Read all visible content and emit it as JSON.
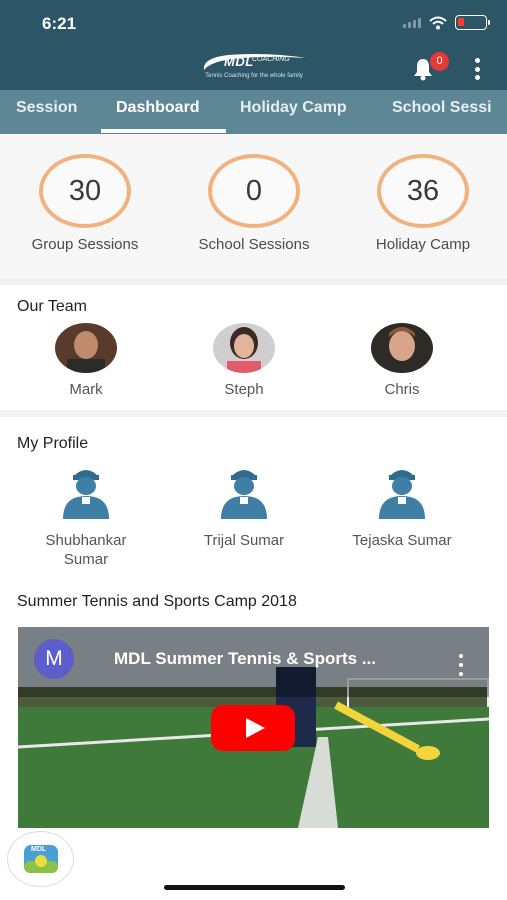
{
  "status_bar": {
    "time": "6:21"
  },
  "header": {
    "logo_main": "MDL",
    "logo_sub": "COACHING",
    "logo_tagline": "Tennis Coaching for the whole family",
    "notification_count": "0"
  },
  "tabs": [
    {
      "label": "Session"
    },
    {
      "label": "Dashboard",
      "active": true
    },
    {
      "label": "Holiday Camp"
    },
    {
      "label": "School Sessi"
    }
  ],
  "stats": [
    {
      "value": "30",
      "label": "Group Sessions"
    },
    {
      "value": "0",
      "label": "School Sessions"
    },
    {
      "value": "36",
      "label": "Holiday Camp"
    }
  ],
  "team": {
    "title": "Our Team",
    "members": [
      {
        "name": "Mark"
      },
      {
        "name": "Steph"
      },
      {
        "name": "Chris"
      }
    ]
  },
  "profile": {
    "title": "My Profile",
    "people": [
      {
        "name_line1": "Shubhankar",
        "name_line2": "Sumar"
      },
      {
        "name_line1": "Trijal Sumar",
        "name_line2": ""
      },
      {
        "name_line1": "Tejaska Sumar",
        "name_line2": ""
      }
    ]
  },
  "video_section": {
    "title": "Summer Tennis and Sports Camp 2018",
    "video_title": "MDL Summer Tennis & Sports ...",
    "channel_initial": "M"
  },
  "fab": {
    "label": "MDL"
  },
  "colors": {
    "header_bg": "#2c5566",
    "tab_bg": "#5e8796",
    "ring": "#f2b27e",
    "profile_icon": "#3f7fa6",
    "badge": "#e53935",
    "play": "#ff0000"
  },
  "icons": [
    "wifi-icon",
    "battery-icon",
    "bell-icon",
    "more-vert-icon",
    "user-icon",
    "play-icon"
  ]
}
